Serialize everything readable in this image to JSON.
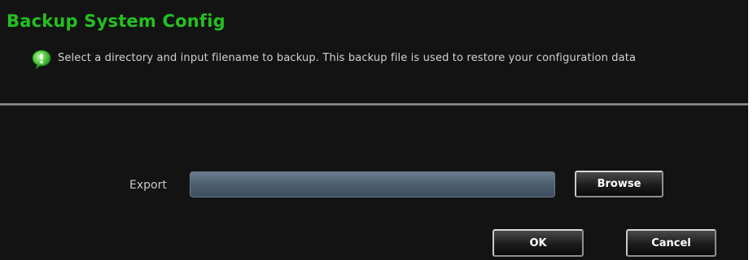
{
  "dialog": {
    "title": "Backup System Config",
    "info_icon": "info-bubble-icon",
    "info_text": "Select a directory and input filename to backup. This backup file is used to restore your configuration data"
  },
  "form": {
    "export_label": "Export",
    "export_value": "",
    "browse_label": "Browse"
  },
  "actions": {
    "ok_label": "OK",
    "cancel_label": "Cancel"
  },
  "colors": {
    "background": "#131313",
    "title": "#24c021",
    "text": "#d2d2d2",
    "input_fill": "#4c5e70",
    "icon_green": "#36b82e"
  }
}
